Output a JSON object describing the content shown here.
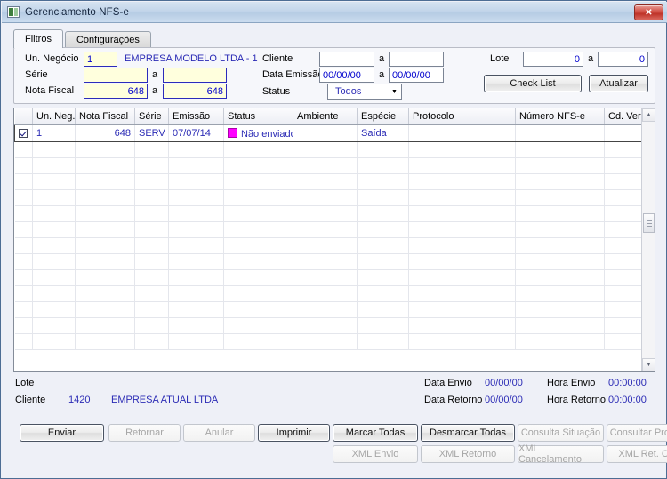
{
  "window": {
    "title": "Gerenciamento NFS-e",
    "close_label": "✕",
    "app_icon": "application-icon"
  },
  "tabs": [
    {
      "label": "Filtros",
      "active": true
    },
    {
      "label": "Configurações",
      "active": false
    }
  ],
  "filters": {
    "un_negocio": {
      "label": "Un. Negócio",
      "value": "1",
      "description": "EMPRESA MODELO LTDA - 1"
    },
    "serie": {
      "label": "Série",
      "from": "",
      "to": "",
      "sep": "a"
    },
    "nota_fiscal": {
      "label": "Nota Fiscal",
      "from": "648",
      "to": "648",
      "sep": "a"
    },
    "cliente": {
      "label": "Cliente",
      "from": "",
      "to": "",
      "sep": "a"
    },
    "data_emissao": {
      "label": "Data Emissão",
      "from": "00/00/00",
      "to": "00/00/00",
      "sep": "a"
    },
    "status": {
      "label": "Status",
      "value": "Todos",
      "arrow": "▼"
    },
    "lote": {
      "label": "Lote",
      "from": "0",
      "to": "0",
      "sep": "a"
    },
    "check_list_button": "Check List",
    "atualizar_button": "Atualizar"
  },
  "grid": {
    "columns": [
      "",
      "Un. Neg.",
      "Nota Fiscal",
      "Série",
      "Emissão",
      "Status",
      "Ambiente",
      "Espécie",
      "Protocolo",
      "Número NFS-e",
      "Cd. Verificação"
    ],
    "rows": [
      {
        "checked": true,
        "un_neg": "1",
        "nota_fiscal": "648",
        "serie": "SERV",
        "emissao": "07/07/14",
        "status": "Não enviado",
        "status_color": "#ff00ff",
        "ambiente": "",
        "especie": "Saída",
        "protocolo": "",
        "numero_nfse": "",
        "cd_verificacao": ""
      }
    ],
    "empty_row_count": 13,
    "scroll_up_arrow": "▲",
    "scroll_down_arrow": "▼"
  },
  "info": {
    "lote_label": "Lote",
    "lote_value": "",
    "cliente_label": "Cliente",
    "cliente_code": "1420",
    "cliente_name": "EMPRESA ATUAL LTDA",
    "data_envio_label": "Data Envio",
    "data_envio_value": "00/00/00",
    "hora_envio_label": "Hora Envio",
    "hora_envio_value": "00:00:00",
    "data_retorno_label": "Data Retorno",
    "data_retorno_value": "00/00/00",
    "hora_retorno_label": "Hora Retorno",
    "hora_retorno_value": "00:00:00"
  },
  "actions": {
    "row1": [
      {
        "label": "Enviar",
        "enabled": true,
        "default": true
      },
      {
        "label": "Retornar",
        "enabled": false,
        "default": false
      },
      {
        "label": "Anular",
        "enabled": false,
        "default": false
      },
      {
        "label": "Imprimir",
        "enabled": true,
        "default": true
      },
      {
        "label": "Marcar Todas",
        "enabled": true,
        "default": true
      },
      {
        "label": "Desmarcar Todas",
        "enabled": true,
        "default": true
      },
      {
        "label": "Consulta Situação",
        "enabled": false,
        "default": false
      },
      {
        "label": "Consultar Protocolo",
        "enabled": false,
        "default": false
      }
    ],
    "row2": [
      {
        "label": "XML Envio",
        "enabled": false,
        "default": false
      },
      {
        "label": "XML Retorno",
        "enabled": false,
        "default": false
      },
      {
        "label": "XML Cancelamento",
        "enabled": false,
        "default": false
      },
      {
        "label": "XML Ret. Canc.",
        "enabled": false,
        "default": false
      }
    ]
  },
  "colors": {
    "field_bg": "#ffffdd",
    "field_border": "#2b2bbb",
    "value_text": "#2b2bb5",
    "status_magenta": "#ff00ff",
    "titlebar": "#c2d5ea",
    "close_red": "#bf342a"
  }
}
